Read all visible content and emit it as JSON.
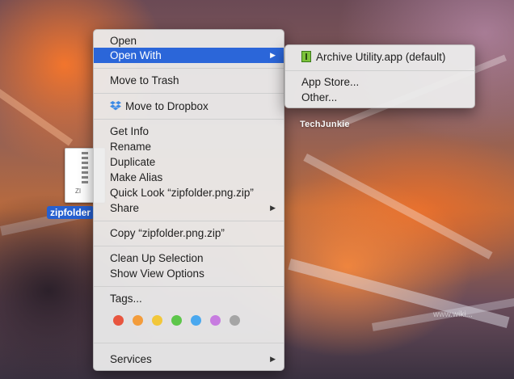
{
  "desktop": {
    "watermark": "TechJunkie",
    "site_watermark": "www.wiki...",
    "file": {
      "label": "zipfolder",
      "icon_text": "ZI"
    }
  },
  "context_menu": {
    "open": "Open",
    "open_with": "Open With",
    "move_to_trash": "Move to Trash",
    "move_to_dropbox": "Move to Dropbox",
    "get_info": "Get Info",
    "rename": "Rename",
    "duplicate": "Duplicate",
    "make_alias": "Make Alias",
    "quick_look": "Quick Look “zipfolder.png.zip”",
    "share": "Share",
    "copy": "Copy “zipfolder.png.zip”",
    "clean_up": "Clean Up Selection",
    "show_view_options": "Show View Options",
    "tags": "Tags...",
    "services": "Services",
    "submenu_arrow_icon": "triangle-right-icon",
    "tag_colors": [
      "#e8553f",
      "#f39c3b",
      "#f2c73a",
      "#5dc64a",
      "#4aa8ef",
      "#c77ce0",
      "#a5a5a5"
    ]
  },
  "open_with_submenu": {
    "default_app": "Archive Utility.app (default)",
    "app_store": "App Store...",
    "other": "Other..."
  },
  "colors": {
    "selection": "#2b66d9"
  }
}
